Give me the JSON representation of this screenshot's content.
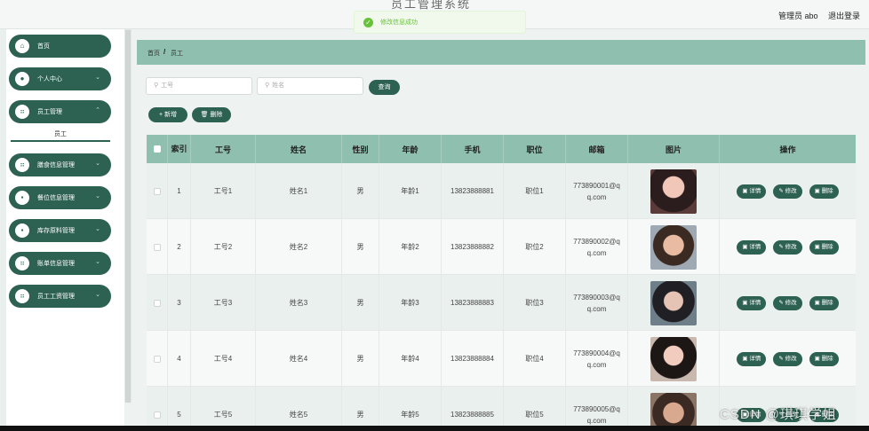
{
  "header": {
    "title": "员工管理系统",
    "admin_label": "管理员 abo",
    "logout_label": "退出登录"
  },
  "toast": {
    "message": "修改信息成功"
  },
  "sidebar": {
    "items": [
      {
        "label": "首页",
        "icon": "home-icon",
        "glyph": "⌂",
        "chevron": ""
      },
      {
        "label": "个人中心",
        "icon": "user-icon",
        "glyph": "●",
        "chevron": "⌄"
      },
      {
        "label": "员工管理",
        "icon": "grid-icon",
        "glyph": "⠶",
        "chevron": "⌃"
      },
      {
        "label": "膳食信息管理",
        "icon": "grid-icon",
        "glyph": "⠶",
        "chevron": "⌄"
      },
      {
        "label": "餐位信息管理",
        "icon": "trash-icon",
        "glyph": "▪",
        "chevron": "⌄"
      },
      {
        "label": "库存原料管理",
        "icon": "trash-icon",
        "glyph": "▪",
        "chevron": "⌄"
      },
      {
        "label": "账单信息管理",
        "icon": "grid-icon",
        "glyph": "⠶",
        "chevron": "⌄"
      },
      {
        "label": "员工工资管理",
        "icon": "grid-icon",
        "glyph": "⠶",
        "chevron": "⌄"
      }
    ],
    "submenu": "员工"
  },
  "breadcrumb": {
    "home": "首页",
    "separator": "/",
    "current": "员工"
  },
  "search": {
    "gonghao_placeholder": "工号",
    "xingming_placeholder": "姓名",
    "query_label": "查询"
  },
  "actions": {
    "add_label": "+ 新增",
    "delete_label": "🗑 删除"
  },
  "table": {
    "headers": [
      "索引",
      "工号",
      "姓名",
      "性别",
      "年龄",
      "手机",
      "职位",
      "邮箱",
      "图片",
      "操作"
    ],
    "op_labels": {
      "detail": "▣ 详情",
      "edit": "✎ 修改",
      "delete": "▣ 删除"
    },
    "rows": [
      {
        "index": "1",
        "gonghao": "工号1",
        "xingming": "姓名1",
        "xingbie": "男",
        "nianling": "年龄1",
        "shouji": "13823888881",
        "zhiwei": "职位1",
        "youxiang": "773890001@qq.com"
      },
      {
        "index": "2",
        "gonghao": "工号2",
        "xingming": "姓名2",
        "xingbie": "男",
        "nianling": "年龄2",
        "shouji": "13823888882",
        "zhiwei": "职位2",
        "youxiang": "773890002@qq.com"
      },
      {
        "index": "3",
        "gonghao": "工号3",
        "xingming": "姓名3",
        "xingbie": "男",
        "nianling": "年龄3",
        "shouji": "13823888883",
        "zhiwei": "职位3",
        "youxiang": "773890003@qq.com"
      },
      {
        "index": "4",
        "gonghao": "工号4",
        "xingming": "姓名4",
        "xingbie": "男",
        "nianling": "年龄4",
        "shouji": "13823888884",
        "zhiwei": "职位4",
        "youxiang": "773890004@qq.com"
      },
      {
        "index": "5",
        "gonghao": "工号5",
        "xingming": "姓名5",
        "xingbie": "男",
        "nianling": "年龄5",
        "shouji": "13823888885",
        "zhiwei": "职位5",
        "youxiang": "773890005@qq.com"
      }
    ]
  },
  "watermark": "CSDN @琪琪学姐",
  "colors": {
    "primary": "#2d6151",
    "table_header": "#8fbfae",
    "success": "#67c23a"
  }
}
